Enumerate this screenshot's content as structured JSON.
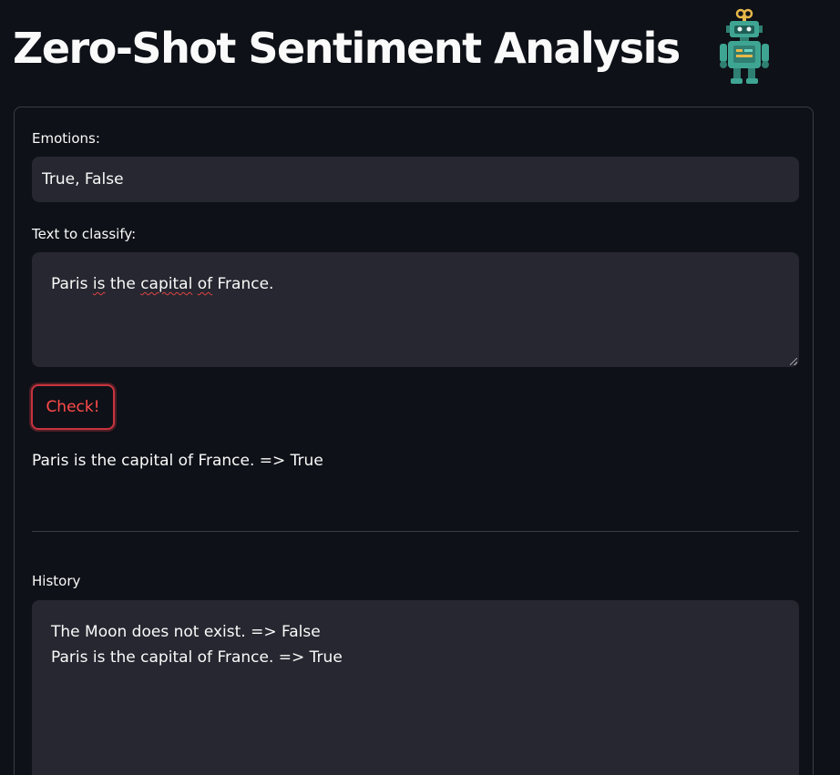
{
  "header": {
    "title": "Zero-Shot Sentiment Analysis",
    "icon": "robot-icon"
  },
  "form": {
    "emotions_label": "Emotions:",
    "emotions_value": "True, False",
    "text_label": "Text to classify:",
    "text_words": [
      "Paris",
      " ",
      "is",
      " ",
      "the",
      " ",
      "capital",
      " ",
      "of",
      " ",
      "France."
    ],
    "check_label": "Check!",
    "result": "Paris is the capital of France. => True"
  },
  "history": {
    "label": "History",
    "lines": [
      "The Moon does not exist. => False",
      "Paris is the capital of France. => True"
    ]
  },
  "colors": {
    "background": "#0e1117",
    "input_background": "#262730",
    "accent": "#ff4b4b",
    "text": "#fafafa"
  }
}
